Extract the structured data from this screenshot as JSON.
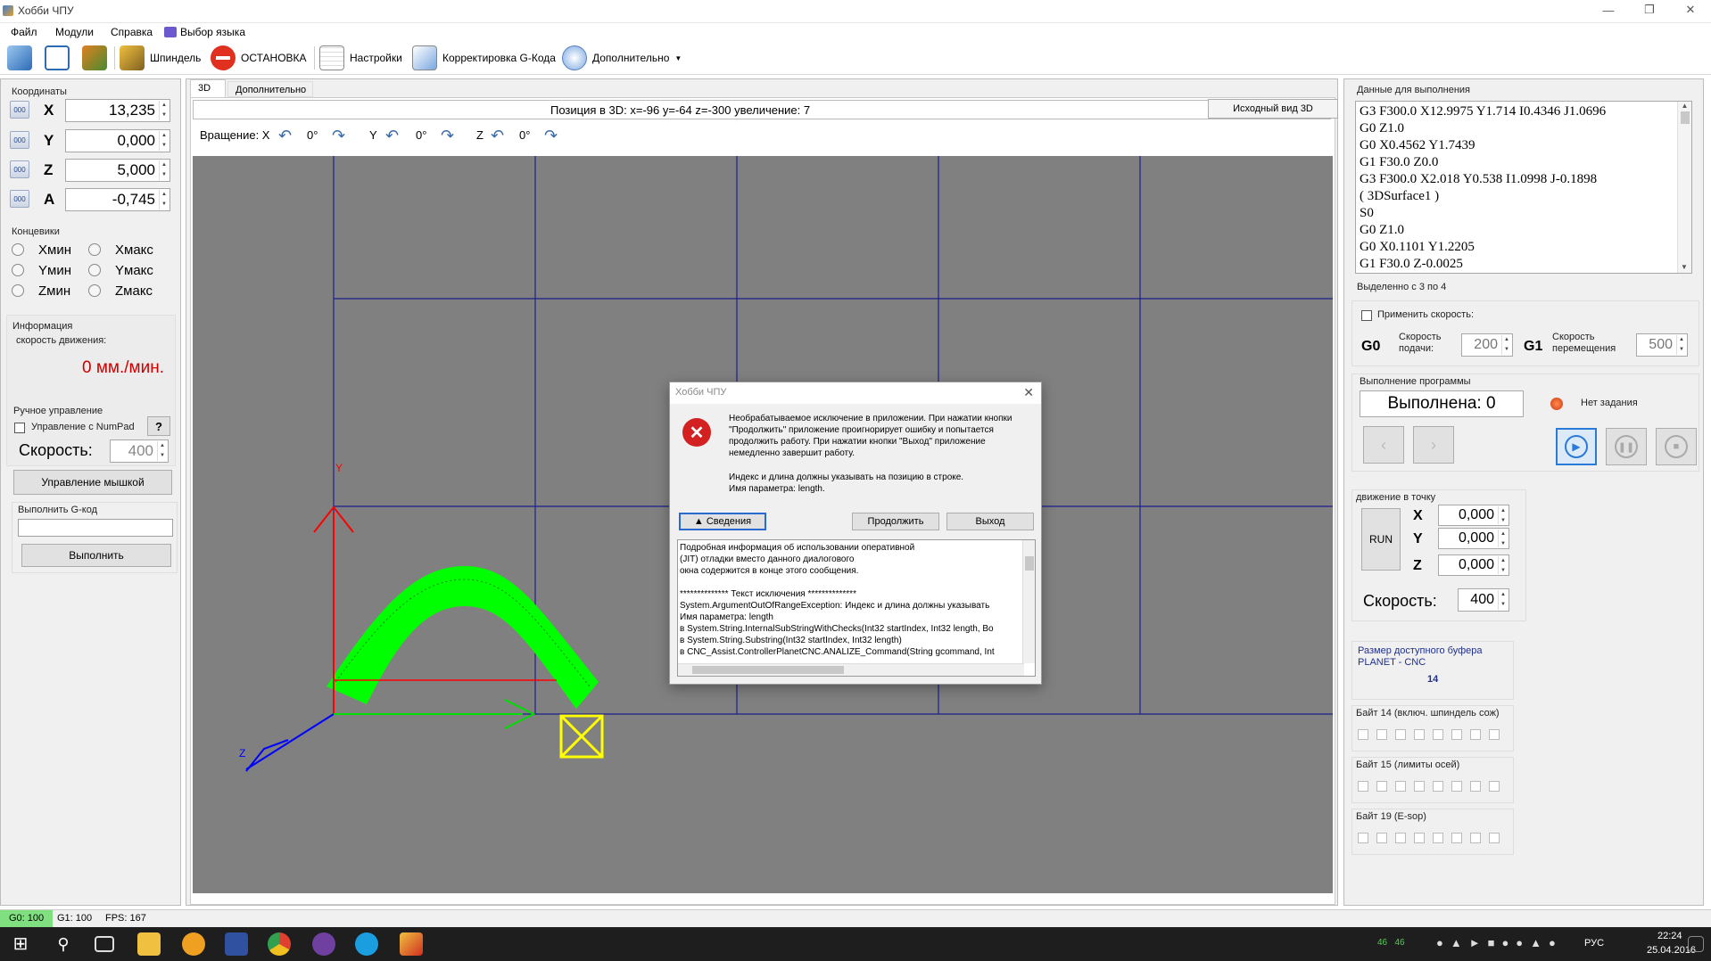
{
  "window": {
    "title": "Хобби ЧПУ"
  },
  "menu": [
    "Файл",
    "Модули",
    "Справка",
    "Выбор языка"
  ],
  "toolbar": {
    "spindle": "Шпиндель",
    "stop": "ОСТАНОВКА",
    "settings": "Настройки",
    "gcode_edit": "Корректировка G-Кода",
    "more": "Дополнительно"
  },
  "coords": {
    "title": "Координаты",
    "btn": "000",
    "axes": [
      {
        "name": "X",
        "value": "13,235"
      },
      {
        "name": "Y",
        "value": "0,000"
      },
      {
        "name": "Z",
        "value": "5,000"
      },
      {
        "name": "A",
        "value": "-0,745"
      }
    ]
  },
  "limits": {
    "title": "Концевики",
    "items": [
      "Xмин",
      "Xмакс",
      "Yмин",
      "Yмакс",
      "Zмин",
      "Zмакс"
    ]
  },
  "info": {
    "title": "Информация",
    "speed_label": "скорость движения:",
    "speed_value": "0 мм./мин."
  },
  "manual": {
    "title": "Ручное управление",
    "numpad": "Управление с NumPad",
    "help": "?",
    "speed_label": "Скорость:",
    "speed_value": "400",
    "mouse_btn": "Управление мышкой"
  },
  "exec_gcode": {
    "title": "Выполнить G-код",
    "input": "",
    "btn": "Выполнить"
  },
  "tabs": [
    "3D",
    "Дополнительно"
  ],
  "view3d": {
    "position": "Позиция в 3D: x=-96 y=-64 z=-300 увеличение: 7",
    "reset_btn": "Исходный вид 3D",
    "rotation_label": "Вращение: X",
    "rx": "0°",
    "ry_label": "Y",
    "ry": "0°",
    "rz_label": "Z",
    "rz": "0°",
    "axis_y": "Y",
    "axis_z": "Z"
  },
  "dialog": {
    "title": "Хобби ЧПУ",
    "message1": "Необрабатываемое исключение в приложении. При нажатии кнопки \"Продолжить\" приложение проигнорирует ошибку и попытается продолжить работу. При нажатии кнопки \"Выход\" приложение немедленно завершит работу.",
    "message2": "Индекс и длина должны указывать на позицию в строке.\nИмя параметра: length.",
    "details_btn": "▲ Сведения",
    "continue_btn": "Продолжить",
    "exit_btn": "Выход",
    "details": [
      "Подробная информация об использовании оперативной",
      "(JIT) отладки вместо данного диалогового",
      "окна содержится в конце этого сообщения.",
      "",
      "************** Текст исключения **************",
      "System.ArgumentOutOfRangeException: Индекс и длина должны указывать",
      "Имя параметра: length",
      "   в System.String.InternalSubStringWithChecks(Int32 startIndex, Int32 length, Bo",
      "   в System.String.Substring(Int32 startIndex, Int32 length)",
      "   в CNC_Assist.ControllerPlanetCNC.ANALIZE_Command(String gcommand, Int"
    ]
  },
  "program": {
    "title": "Данные для выполнения",
    "lines": [
      "G3 F300.0 X12.9975 Y1.714 I0.4346 J1.0696",
      "G0 Z1.0",
      "G0 X0.4562 Y1.7439",
      "G1 F30.0 Z0.0",
      "G3 F300.0 X2.018 Y0.538 I1.0998 J-0.1898",
      "( 3DSurface1 )",
      "S0",
      "G0 Z1.0",
      "G0 X0.1101 Y1.2205",
      "G1 F30.0 Z-0.0025"
    ],
    "selected": "Выделенно с 3 по 4"
  },
  "speed": {
    "apply": "Применить скорость:",
    "g0": "G0",
    "feed": "Скорость подачи:",
    "feed_value": "200",
    "g1": "G1",
    "move": "Скорость перемещения",
    "move_value": "500"
  },
  "execution": {
    "title": "Выполнение программы",
    "done": "Выполнена: 0",
    "status": "Нет задания",
    "prev": "‹",
    "next": "›"
  },
  "move_to": {
    "title": "движение в точку",
    "run": "RUN",
    "axes": [
      {
        "name": "X",
        "value": "0,000"
      },
      {
        "name": "Y",
        "value": "0,000"
      },
      {
        "name": "Z",
        "value": "0,000"
      }
    ],
    "speed_label": "Скорость:",
    "speed_value": "400"
  },
  "buffer": {
    "title": "Размер доступного буфера PLANET - CNC",
    "value": "14"
  },
  "bytes": [
    {
      "title": "Байт 14 (включ. шпиндель сож)"
    },
    {
      "title": "Байт 15 (лимиты осей)"
    },
    {
      "title": "Байт 19 (E-sop)"
    }
  ],
  "statusbar": {
    "g0": "G0: 100",
    "g1": "G1: 100",
    "fps": "FPS: 167"
  },
  "taskbar": {
    "tray_nums": "46   46",
    "lang": "РУС",
    "time": "22:24",
    "date": "25.04.2016"
  },
  "colors": {
    "viewport": "#808080",
    "grid": "#1e1e8c",
    "toolpath": "#00ff00",
    "red_axis": "#ff0000",
    "green_axis": "#00dd00",
    "blue_axis": "#0000ff",
    "tool": "#ffff00",
    "alert": "#cc0000"
  }
}
